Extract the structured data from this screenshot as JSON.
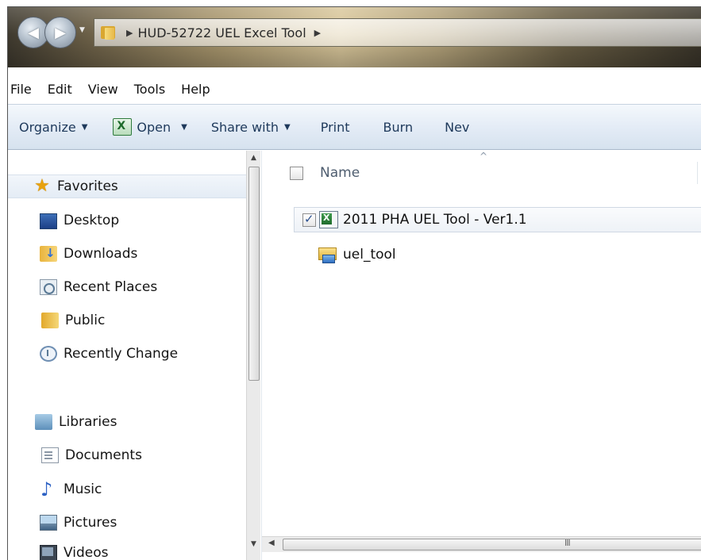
{
  "address": {
    "path": "HUD-52722 UEL Excel Tool"
  },
  "menu": [
    "File",
    "Edit",
    "View",
    "Tools",
    "Help"
  ],
  "commands": {
    "organize": "Organize",
    "open": "Open",
    "share_with": "Share with",
    "print": "Print",
    "burn": "Burn",
    "new_folder_partial": "Nev"
  },
  "navigation": {
    "favorites": "Favorites",
    "favorites_items": [
      "Desktop",
      "Downloads",
      "Recent Places",
      "Public",
      "Recently Change"
    ],
    "libraries": "Libraries",
    "libraries_items": [
      "Documents",
      "Music",
      "Pictures",
      "Videos"
    ]
  },
  "content": {
    "column_name": "Name",
    "files": [
      {
        "name": "2011 PHA UEL Tool - Ver1.1",
        "checked": true,
        "icon": "excel-file-icon"
      },
      {
        "name": "uel_tool",
        "checked": false,
        "icon": "shortcut-icon"
      }
    ]
  },
  "scrollbars": {
    "grip_glyph": "III"
  }
}
